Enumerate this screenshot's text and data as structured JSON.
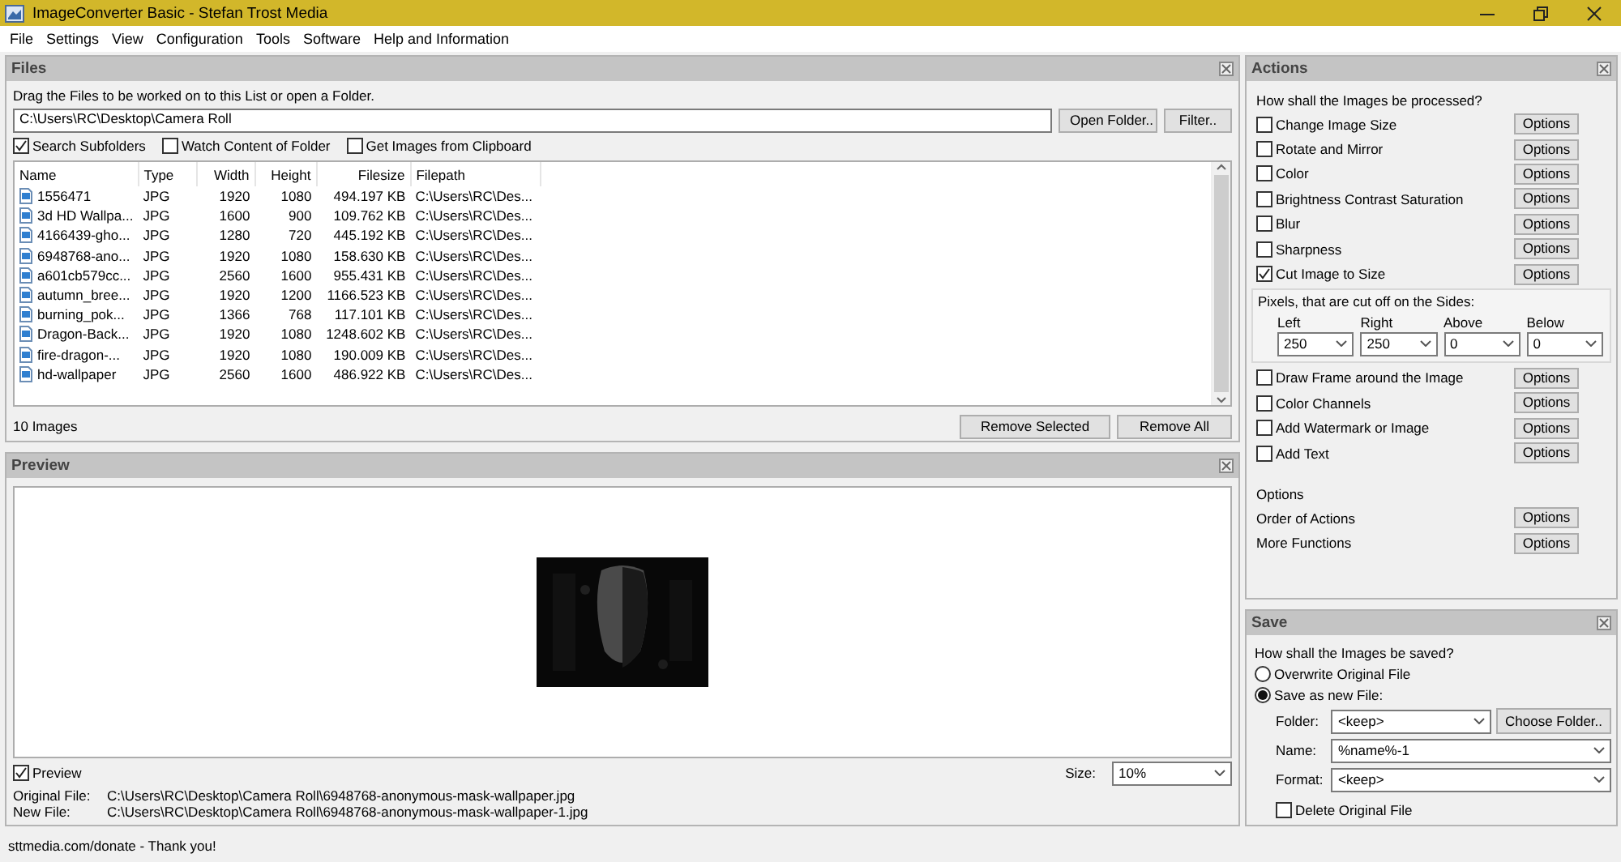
{
  "window": {
    "title": "ImageConverter Basic - Stefan Trost Media"
  },
  "menu": [
    "File",
    "Settings",
    "View",
    "Configuration",
    "Tools",
    "Software",
    "Help and Information"
  ],
  "files": {
    "title": "Files",
    "hint": "Drag the Files to be worked on to this List or open a Folder.",
    "path": {
      "value": "C:\\Users\\RC\\Desktop\\Camera Roll"
    },
    "path_buttons": [
      "Open Folder..",
      "Filter.."
    ],
    "options": [
      {
        "label": "Search Subfolders",
        "checked": true
      },
      {
        "label": "Watch Content of Folder",
        "checked": false
      },
      {
        "label": "Get Images from Clipboard",
        "checked": false
      }
    ],
    "table": {
      "columns": [
        "Name",
        "Type",
        "Width",
        "Height",
        "Filesize",
        "Filepath"
      ],
      "rows": [
        [
          "1556471",
          "JPG",
          "1920",
          "1080",
          "494.197 KB",
          "C:\\Users\\RC\\Des..."
        ],
        [
          "3d HD Wallpa...",
          "JPG",
          "1600",
          "900",
          "109.762 KB",
          "C:\\Users\\RC\\Des..."
        ],
        [
          "4166439-gho...",
          "JPG",
          "1280",
          "720",
          "445.192 KB",
          "C:\\Users\\RC\\Des..."
        ],
        [
          "6948768-ano...",
          "JPG",
          "1920",
          "1080",
          "158.630 KB",
          "C:\\Users\\RC\\Des..."
        ],
        [
          "a601cb579cc...",
          "JPG",
          "2560",
          "1600",
          "955.431 KB",
          "C:\\Users\\RC\\Des..."
        ],
        [
          "autumn_bree...",
          "JPG",
          "1920",
          "1200",
          "1166.523 KB",
          "C:\\Users\\RC\\Des..."
        ],
        [
          "burning_pok...",
          "JPG",
          "1366",
          "768",
          "117.101 KB",
          "C:\\Users\\RC\\Des..."
        ],
        [
          "Dragon-Back...",
          "JPG",
          "1920",
          "1080",
          "1248.602 KB",
          "C:\\Users\\RC\\Des..."
        ],
        [
          "fire-dragon-...",
          "JPG",
          "1920",
          "1080",
          "190.009 KB",
          "C:\\Users\\RC\\Des..."
        ],
        [
          "hd-wallpaper",
          "JPG",
          "2560",
          "1600",
          "486.922 KB",
          "C:\\Users\\RC\\Des..."
        ]
      ]
    },
    "count": "10 Images",
    "list_buttons": [
      "Remove Selected",
      "Remove All"
    ]
  },
  "preview": {
    "title": "Preview",
    "show": {
      "label": "Preview",
      "checked": true
    },
    "size_label": "Size:",
    "size_value": "10%",
    "info": [
      {
        "label": "Original File:",
        "value": "C:\\Users\\RC\\Desktop\\Camera Roll\\6948768-anonymous-mask-wallpaper.jpg"
      },
      {
        "label": "New File:",
        "value": "C:\\Users\\RC\\Desktop\\Camera Roll\\6948768-anonymous-mask-wallpaper-1.jpg"
      }
    ]
  },
  "actions": {
    "title": "Actions",
    "prompt": "How shall the Images be processed?",
    "items": [
      {
        "label": "Change Image Size",
        "checked": false,
        "button": "Options"
      },
      {
        "label": "Rotate and Mirror",
        "checked": false,
        "button": "Options"
      },
      {
        "label": "Color",
        "checked": false,
        "button": "Options"
      },
      {
        "label": "Brightness Contrast Saturation",
        "checked": false,
        "button": "Options"
      },
      {
        "label": "Blur",
        "checked": false,
        "button": "Options"
      },
      {
        "label": "Sharpness",
        "checked": false,
        "button": "Options"
      },
      {
        "label": "Cut Image to Size",
        "checked": true,
        "button": "Options",
        "settings": {
          "title": "Pixels, that are cut off on the Sides:",
          "fields": [
            {
              "label": "Left",
              "value": "250"
            },
            {
              "label": "Right",
              "value": "250"
            },
            {
              "label": "Above",
              "value": "0"
            },
            {
              "label": "Below",
              "value": "0"
            }
          ]
        }
      },
      {
        "label": "Draw Frame around the Image",
        "checked": false,
        "button": "Options"
      },
      {
        "label": "Color Channels",
        "checked": false,
        "button": "Options"
      },
      {
        "label": "Add Watermark or Image",
        "checked": false,
        "button": "Options"
      },
      {
        "label": "Add Text",
        "checked": false,
        "button": "Options"
      }
    ],
    "options_heading": "Options",
    "more": [
      {
        "label": "Order of Actions",
        "button": "Options"
      },
      {
        "label": "More Functions",
        "button": "Options"
      }
    ]
  },
  "save": {
    "title": "Save",
    "prompt": "How shall the Images be saved?",
    "modes": [
      {
        "label": "Overwrite Original File",
        "selected": false
      },
      {
        "label": "Save as new File:",
        "selected": true
      }
    ],
    "fields": [
      {
        "label": "Folder:",
        "value": "<keep>",
        "button": "Choose Folder.."
      },
      {
        "label": "Name:",
        "value": "%name%-1"
      },
      {
        "label": "Format:",
        "value": "<keep>"
      }
    ],
    "delete": {
      "label": "Delete Original File",
      "checked": false
    }
  },
  "status_bar": "sttmedia.com/donate - Thank you!"
}
